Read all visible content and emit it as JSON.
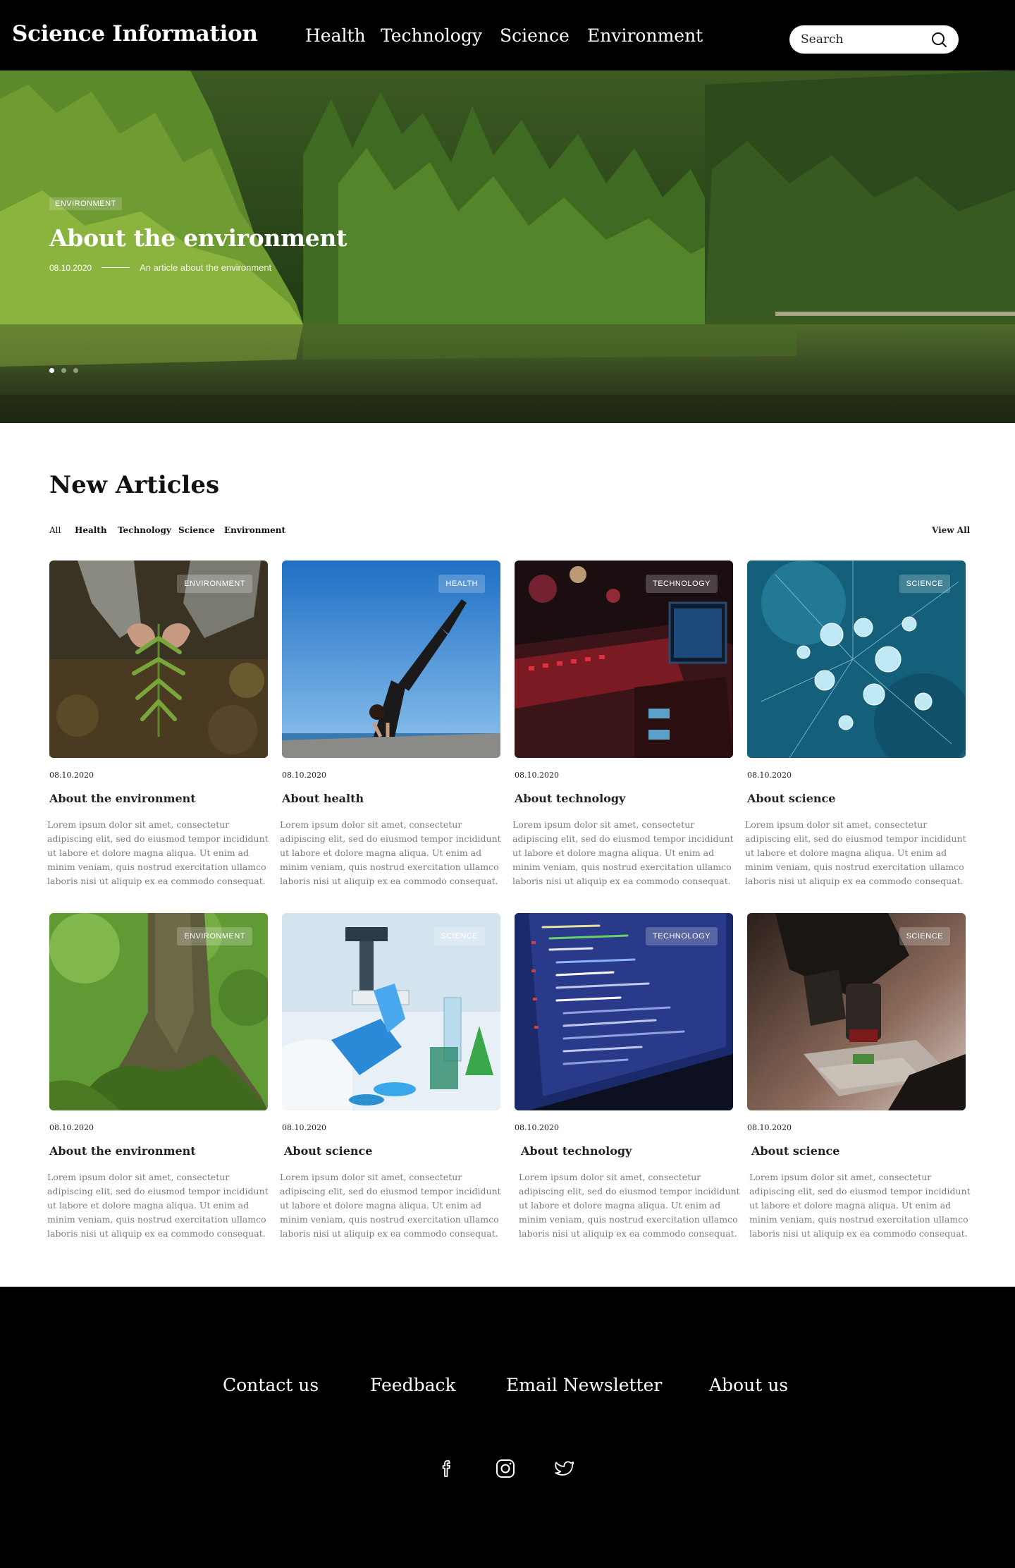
{
  "header": {
    "logo": "Science Information",
    "nav": [
      {
        "label": "Health"
      },
      {
        "label": "Technology"
      },
      {
        "label": "Science"
      },
      {
        "label": "Environment"
      }
    ],
    "search": {
      "placeholder": "Search",
      "icon": "search-icon"
    }
  },
  "hero": {
    "badge": "ENVIRONMENT",
    "title": "About the environment",
    "date": "08.10.2020",
    "subtitle": "An article about the environment",
    "slides": 3,
    "active_slide": 1
  },
  "articles": {
    "title": "New Articles",
    "filters": [
      "All",
      "Health",
      "Technology",
      "Science",
      "Environment"
    ],
    "view_all": "View All",
    "items": [
      {
        "badge": "ENVIRONMENT",
        "date": "08.10.2020",
        "title": "About the environment",
        "text": "Lorem ipsum dolor sit amet, consectetur adipiscing elit, sed do eiusmod tempor incididunt ut labore et dolore magna aliqua. Ut enim ad minim veniam, quis nostrud exercitation ullamco laboris nisi ut aliquip ex ea commodo consequat."
      },
      {
        "badge": "HEALTH",
        "date": "08.10.2020",
        "title": "About health",
        "text": "Lorem ipsum dolor sit amet, consectetur adipiscing elit, sed do eiusmod tempor incididunt ut labore et dolore magna aliqua. Ut enim ad minim veniam, quis nostrud exercitation ullamco laboris nisi ut aliquip ex ea commodo consequat."
      },
      {
        "badge": "TECHNOLOGY",
        "date": "08.10.2020",
        "title": "About technology",
        "text": "Lorem ipsum dolor sit amet, consectetur adipiscing elit, sed do eiusmod tempor incididunt ut labore et dolore magna aliqua. Ut enim ad minim veniam, quis nostrud exercitation ullamco laboris nisi ut aliquip ex ea commodo consequat."
      },
      {
        "badge": "SCIENCE",
        "date": "08.10.2020",
        "title": "About science",
        "text": "Lorem ipsum dolor sit amet, consectetur adipiscing elit, sed do eiusmod tempor incididunt ut labore et dolore magna aliqua. Ut enim ad minim veniam, quis nostrud exercitation ullamco laboris nisi ut aliquip ex ea commodo consequat."
      },
      {
        "badge": "ENVIRONMENT",
        "date": "08.10.2020",
        "title": "About the environment",
        "text": "Lorem ipsum dolor sit amet, consectetur adipiscing elit, sed do eiusmod tempor incididunt ut labore et dolore magna aliqua. Ut enim ad minim veniam, quis nostrud exercitation ullamco laboris nisi ut aliquip ex ea commodo consequat."
      },
      {
        "badge": "SCIENCE",
        "date": "08.10.2020",
        "title": "About science",
        "text": "Lorem ipsum dolor sit amet, consectetur adipiscing elit, sed do eiusmod tempor incididunt ut labore et dolore magna aliqua. Ut enim ad minim veniam, quis nostrud exercitation ullamco laboris nisi ut aliquip ex ea commodo consequat."
      },
      {
        "badge": "TECHNOLOGY",
        "date": "08.10.2020",
        "title": "About technology",
        "text": "Lorem ipsum dolor sit amet, consectetur adipiscing elit, sed do eiusmod tempor incididunt ut labore et dolore magna aliqua. Ut enim ad minim veniam, quis nostrud exercitation ullamco laboris nisi ut aliquip ex ea commodo consequat."
      },
      {
        "badge": "SCIENCE",
        "date": "08.10.2020",
        "title": "About science",
        "text": "Lorem ipsum dolor sit amet, consectetur adipiscing elit, sed do eiusmod tempor incididunt ut labore et dolore magna aliqua. Ut enim ad minim veniam, quis nostrud exercitation ullamco laboris nisi ut aliquip ex ea commodo consequat."
      }
    ]
  },
  "footer": {
    "links": [
      "Contact us",
      "Feedback",
      "Email Newsletter",
      "About us"
    ],
    "social": [
      "facebook-icon",
      "instagram-icon",
      "twitter-icon"
    ]
  }
}
